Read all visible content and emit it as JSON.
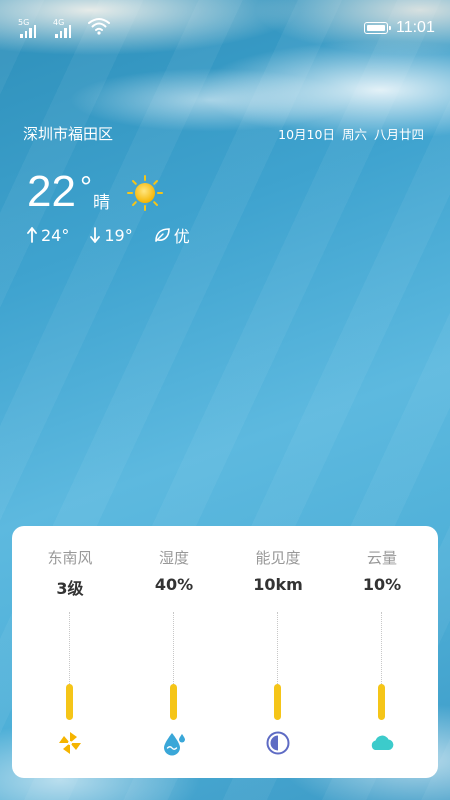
{
  "status_bar": {
    "sim1_label": "5G",
    "sim2_label": "4G",
    "wifi_icon": "wifi-icon",
    "battery_icon": "battery-icon",
    "time": "11:01"
  },
  "header": {
    "location": "深圳市福田区",
    "date": "10月10日",
    "weekday": "周六",
    "lunar_date": "八月廿四"
  },
  "current": {
    "temperature": "22",
    "degree_symbol": "°",
    "condition": "晴",
    "condition_icon": "sun-icon",
    "high": "24°",
    "low": "19°",
    "air_quality": "优"
  },
  "details": [
    {
      "label": "东南风",
      "value": "3级",
      "icon": "pinwheel-icon",
      "color": "#f5b400"
    },
    {
      "label": "湿度",
      "value": "40%",
      "icon": "water-drop-icon",
      "color": "#3aa7d8"
    },
    {
      "label": "能见度",
      "value": "10km",
      "icon": "contrast-icon",
      "color": "#5e6bc4"
    },
    {
      "label": "云量",
      "value": "10%",
      "icon": "cloud-icon",
      "color": "#3ccbcb"
    }
  ],
  "colors": {
    "accent_bar": "#f5c518",
    "label_gray": "#999999",
    "value_dark": "#333333"
  }
}
